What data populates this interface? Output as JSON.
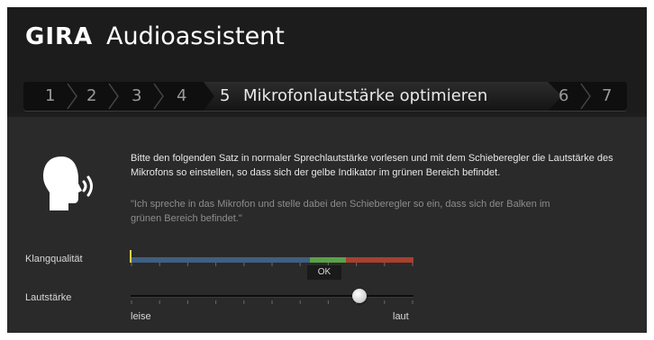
{
  "header": {
    "brand": "GIRA",
    "title": "Audioassistent"
  },
  "steps": [
    {
      "number": "1",
      "label": "",
      "active": false
    },
    {
      "number": "2",
      "label": "",
      "active": false
    },
    {
      "number": "3",
      "label": "",
      "active": false
    },
    {
      "number": "4",
      "label": "",
      "active": false
    },
    {
      "number": "5",
      "label": "Mikrofonlautstärke optimieren",
      "active": true
    },
    {
      "number": "6",
      "label": "",
      "active": false
    },
    {
      "number": "7",
      "label": "",
      "active": false
    }
  ],
  "content": {
    "instruction": "Bitte den folgenden Satz in normaler Sprechlautstärke vorlesen und mit dem Schieberegler die Lautstärke des Mikrofons so einstellen, so dass sich der gelbe Indikator im grünen Bereich befindet.",
    "quote": "\"Ich spreche in das Mikrofon und stelle dabei den Schieberegler so ein, dass sich der Balken im grünen Bereich befindet.\""
  },
  "quality_meter": {
    "label": "Klangqualität",
    "status": "OK",
    "indicator_level": 0.0,
    "zones": [
      {
        "name": "low",
        "color": "#3f5f82",
        "fraction": 0.635
      },
      {
        "name": "ok",
        "color": "#5aa04a",
        "fraction": 0.127
      },
      {
        "name": "high",
        "color": "#a8402e",
        "fraction": 0.238
      }
    ]
  },
  "volume_slider": {
    "label": "Lautstärke",
    "min_label": "leise",
    "max_label": "laut",
    "value": 0.81
  },
  "colors": {
    "indicator": "#e6d24a",
    "background": "#2a2a2a",
    "header": "#1c1c1c"
  },
  "icons": {
    "speaker": "speaking-head-icon"
  }
}
